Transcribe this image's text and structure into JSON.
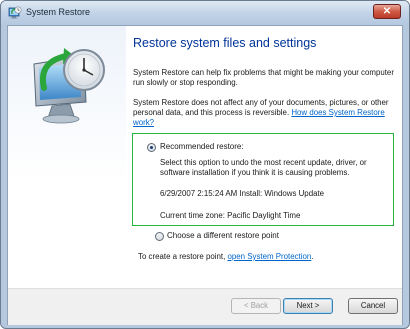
{
  "window": {
    "title": "System Restore",
    "close_glyph": "✕"
  },
  "content": {
    "heading": "Restore system files and settings",
    "para1": "System Restore can help fix problems that might be making your computer run slowly or stop responding.",
    "para2": "System Restore does not affect any of your documents, pictures, or other personal data, and this process is reversible.",
    "para2_link": "How does System Restore work?"
  },
  "recommended": {
    "label": "Recommended restore:",
    "selected": true,
    "description": "Select this option to undo the most recent update, driver, or software installation if you think it is causing problems.",
    "restore_point": "6/29/2007 2:15:24 AM  Install: Windows Update",
    "time_zone": "Current time zone: Pacific Daylight Time"
  },
  "different": {
    "label": "Choose a different restore point",
    "selected": false
  },
  "create_point": {
    "text": "To create a restore point, ",
    "link": "open System Protection",
    "suffix": "."
  },
  "buttons": {
    "back": "< Back",
    "next": "Next >",
    "cancel": "Cancel"
  },
  "icons": {
    "title": "system-restore-icon",
    "side": "system-restore-clock-monitor-icon"
  },
  "colors": {
    "heading": "#003399",
    "link": "#0066cc",
    "selection_border": "#27b53a"
  }
}
